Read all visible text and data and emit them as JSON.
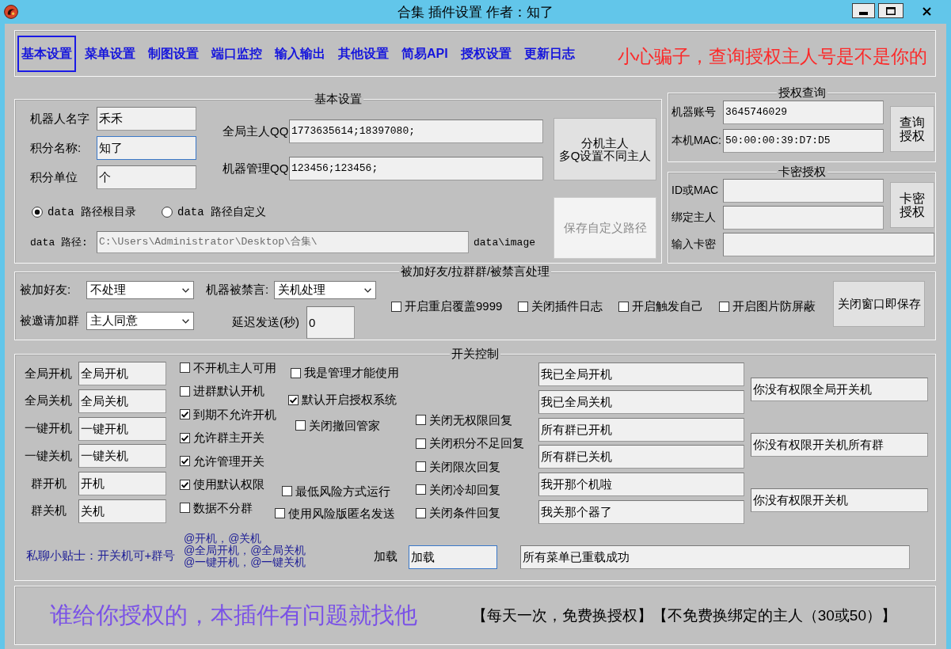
{
  "window": {
    "title": "合集 插件设置 作者：知了"
  },
  "tabs": [
    {
      "label": "基本设置",
      "selected": true
    },
    {
      "label": "菜单设置",
      "selected": false
    },
    {
      "label": "制图设置",
      "selected": false
    },
    {
      "label": "端口监控",
      "selected": false
    },
    {
      "label": "输入输出",
      "selected": false
    },
    {
      "label": "其他设置",
      "selected": false
    },
    {
      "label": "简易API",
      "selected": false
    },
    {
      "label": "授权设置",
      "selected": false
    },
    {
      "label": "更新日志",
      "selected": false
    }
  ],
  "warning": "小心骗子，查询授权主人号是不是你的",
  "basic_settings": {
    "title": "基本设置",
    "fields": [
      {
        "label": "机器人名字",
        "value": "禾禾",
        "focused": false
      },
      {
        "label": "积分名称:",
        "value": "知了",
        "focused": true
      },
      {
        "label": "积分单位",
        "value": "个",
        "focused": false
      }
    ],
    "qq_fields": [
      {
        "label": "全局主人QQ",
        "value": "1773635614;18397080;"
      },
      {
        "label": "机器管理QQ",
        "value": "123456;123456;"
      }
    ],
    "owner_button": {
      "label_lines": [
        "分机主人",
        "多Q设置不同主人"
      ],
      "disabled": false
    },
    "path_options": [
      {
        "label": "data 路径根目录",
        "selected": true
      },
      {
        "label": "data 路径自定义",
        "selected": false
      }
    ],
    "path": {
      "label": "data 路径:",
      "value": "C:\\Users\\Administrator\\Desktop\\合集\\",
      "disabled": true,
      "suffix": "data\\image"
    },
    "save_path_button": {
      "label": "保存自定义路径",
      "disabled": true
    }
  },
  "auth_query": {
    "title": "授权查询",
    "fields": [
      {
        "label": "机器账号",
        "value": "3645746029"
      },
      {
        "label": "本机MAC:",
        "value": "50:00:00:39:D7:D5"
      }
    ],
    "button": {
      "label": "查询授权",
      "disabled": false
    }
  },
  "card_auth": {
    "title": "卡密授权",
    "fields": [
      {
        "label": "ID或MAC"
      },
      {
        "label": "绑定主人"
      },
      {
        "label": "输入卡密"
      }
    ],
    "button": {
      "label": "卡密授权",
      "disabled": false
    }
  },
  "event_handling": {
    "title": "被加好友/拉群群/被禁言处理",
    "dropdowns": [
      {
        "label": "被加好友:",
        "value": "不处理"
      },
      {
        "label": "被邀请加群",
        "value": "主人同意"
      },
      {
        "label": "机器被禁言:",
        "value": "关机处理"
      }
    ],
    "delay": {
      "label": "延迟发送(秒)",
      "value": "0"
    },
    "options": [
      {
        "label": "开启重启覆盖9999",
        "checked": false
      },
      {
        "label": "关闭插件日志",
        "checked": false
      },
      {
        "label": "开启触发自己",
        "checked": false
      },
      {
        "label": "开启图片防屏蔽",
        "checked": false
      }
    ],
    "save_button": {
      "label": "关闭窗口即保存",
      "disabled": false
    }
  },
  "switch_control": {
    "title": "开关控制",
    "commands": [
      {
        "label": "全局开机",
        "value": "全局开机"
      },
      {
        "label": "全局关机",
        "value": "全局关机"
      },
      {
        "label": "一键开机",
        "value": "一键开机"
      },
      {
        "label": "一键关机",
        "value": "一键关机"
      },
      {
        "label": "群开机",
        "value": "开机"
      },
      {
        "label": "群关机",
        "value": "关机"
      }
    ],
    "options_column_1": [
      {
        "label": "不开机主人可用",
        "checked": false
      },
      {
        "label": "进群默认开机",
        "checked": false
      },
      {
        "label": "到期不允许开机",
        "checked": true
      },
      {
        "label": "允许群主开关",
        "checked": true
      },
      {
        "label": "允许管理开关",
        "checked": true
      },
      {
        "label": "使用默认权限",
        "checked": true
      },
      {
        "label": "数据不分群",
        "checked": false
      }
    ],
    "options_column_2": [
      {
        "label": "我是管理才能使用",
        "checked": false
      },
      {
        "label": "默认开启授权系统",
        "checked": true
      },
      {
        "label": "关闭撤回管家",
        "checked": false
      },
      {
        "label": "最低风险方式运行",
        "checked": false
      },
      {
        "label": "使用风险版匿名发送",
        "checked": false
      }
    ],
    "reply_options": [
      {
        "label": "关闭无权限回复",
        "checked": false
      },
      {
        "label": "关闭积分不足回复",
        "checked": false
      },
      {
        "label": "关闭限次回复",
        "checked": false
      },
      {
        "label": "关闭冷却回复",
        "checked": false
      },
      {
        "label": "关闭条件回复",
        "checked": false
      }
    ],
    "replies": [
      "我已全局开机",
      "我已全局关机",
      "所有群已开机",
      "所有群已关机",
      "我开那个机啦",
      "我关那个器了"
    ],
    "denials": [
      "你没有权限全局开关机",
      "你没有权限开关机所有群",
      "你没有权限开关机"
    ],
    "tip": "私聊小贴士：开关机可+群号",
    "examples": [
      "@开机，@关机",
      "@全局开机，@全局关机",
      "@一键开机，@一键关机"
    ],
    "reload": {
      "label": "加载",
      "value": "加载",
      "focused": true
    },
    "reload_message": "所有菜单已重载成功"
  },
  "footer": {
    "contact": "谁给你授权的，本插件有问题就找他",
    "note": "【每天一次，免费换授权】【不免费换绑定的主人（30或50）】"
  }
}
